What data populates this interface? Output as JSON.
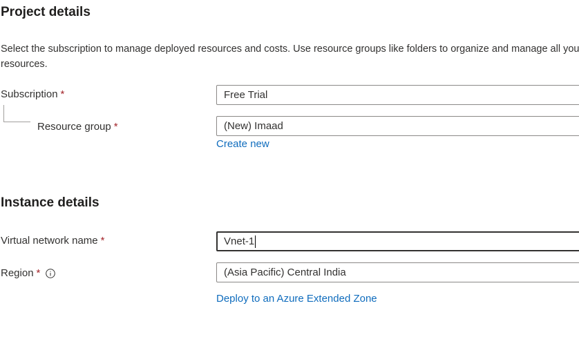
{
  "project_details": {
    "heading": "Project details",
    "description": "Select the subscription to manage deployed resources and costs. Use resource groups like folders to organize and manage all your resources.",
    "subscription": {
      "label": "Subscription",
      "required_mark": "*",
      "value": "Free Trial"
    },
    "resource_group": {
      "label": "Resource group",
      "required_mark": "*",
      "value": "(New) Imaad",
      "create_link": "Create new"
    }
  },
  "instance_details": {
    "heading": "Instance details",
    "vnet_name": {
      "label": "Virtual network name",
      "required_mark": "*",
      "value": "Vnet-1"
    },
    "region": {
      "label": "Region",
      "required_mark": "*",
      "value": "(Asia Pacific) Central India",
      "extended_zone_link": "Deploy to an Azure Extended Zone"
    }
  },
  "colors": {
    "link": "#0f6cbd",
    "required": "#a4262c",
    "text": "#323130"
  },
  "icons": {
    "region_info": "info-icon"
  }
}
